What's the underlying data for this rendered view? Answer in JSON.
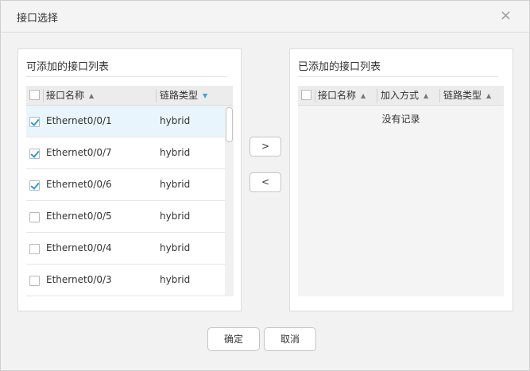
{
  "dialog": {
    "title": "接口选择",
    "close_icon": "×"
  },
  "available": {
    "title": "可添加的接口列表",
    "columns": {
      "name": "接口名称",
      "type": "链路类型"
    },
    "sort_icon": "▲",
    "active_sort_icon": "▼",
    "rows": [
      {
        "name": "Ethernet0/0/1",
        "type": "hybrid",
        "checked": true
      },
      {
        "name": "Ethernet0/0/7",
        "type": "hybrid",
        "checked": true
      },
      {
        "name": "Ethernet0/0/6",
        "type": "hybrid",
        "checked": true
      },
      {
        "name": "Ethernet0/0/5",
        "type": "hybrid",
        "checked": false
      },
      {
        "name": "Ethernet0/0/4",
        "type": "hybrid",
        "checked": false
      },
      {
        "name": "Ethernet0/0/3",
        "type": "hybrid",
        "checked": false
      }
    ]
  },
  "added": {
    "title": "已添加的接口列表",
    "columns": {
      "name": "接口名称",
      "mode": "加入方式",
      "type": "链路类型"
    },
    "sort_icon": "▲",
    "empty_text": "没有记录"
  },
  "transfer": {
    "add_label": ">",
    "remove_label": "<"
  },
  "footer": {
    "ok_label": "确定",
    "cancel_label": "取消"
  },
  "colors": {
    "accent": "#36a8e0",
    "selected_row": "#e9f5fd",
    "checkbox_check": "#2a9ad8"
  }
}
